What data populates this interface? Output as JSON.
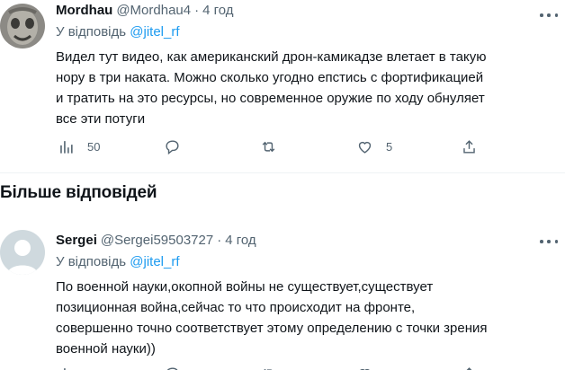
{
  "tweets": [
    {
      "name": "Mordhau",
      "handle": "@Mordhau4",
      "sep": "·",
      "time": "4 год",
      "reply_prefix": "У відповідь",
      "reply_to": "@jitel_rf",
      "text": "Видел тут видео, как американский дрон-камикадзе влетает в такую\nнору в три наката. Можно сколько угодно епстись с фортификацией\nи тратить на это ресурсы, но современное оружие по ходу обнуляет\nвсе эти потуги",
      "stats": {
        "views": "50",
        "replies": "",
        "retweets": "",
        "likes": "5"
      }
    },
    {
      "name": "Sergei",
      "handle": "@Sergei59503727",
      "sep": "·",
      "time": "4 год",
      "reply_prefix": "У відповідь",
      "reply_to": "@jitel_rf",
      "text": "По военной науки,окопной войны не существует,существует\nпозиционная война,сейчас то что происходит на фронте,\nсовершенно точно соответствует этому определению с точки зрения\nвоенной науки))",
      "stats": {
        "views": "",
        "replies": "",
        "retweets": "",
        "likes": ""
      }
    }
  ],
  "section_title": "Більше відповідей",
  "colors": {
    "text": "#0f1419",
    "secondary": "#536471",
    "link": "#1d9bf0",
    "divider": "#eff3f4",
    "avatar_default": "#cfd9de"
  },
  "icons": [
    "views-icon",
    "reply-icon",
    "retweet-icon",
    "like-icon",
    "share-icon",
    "more-icon"
  ]
}
